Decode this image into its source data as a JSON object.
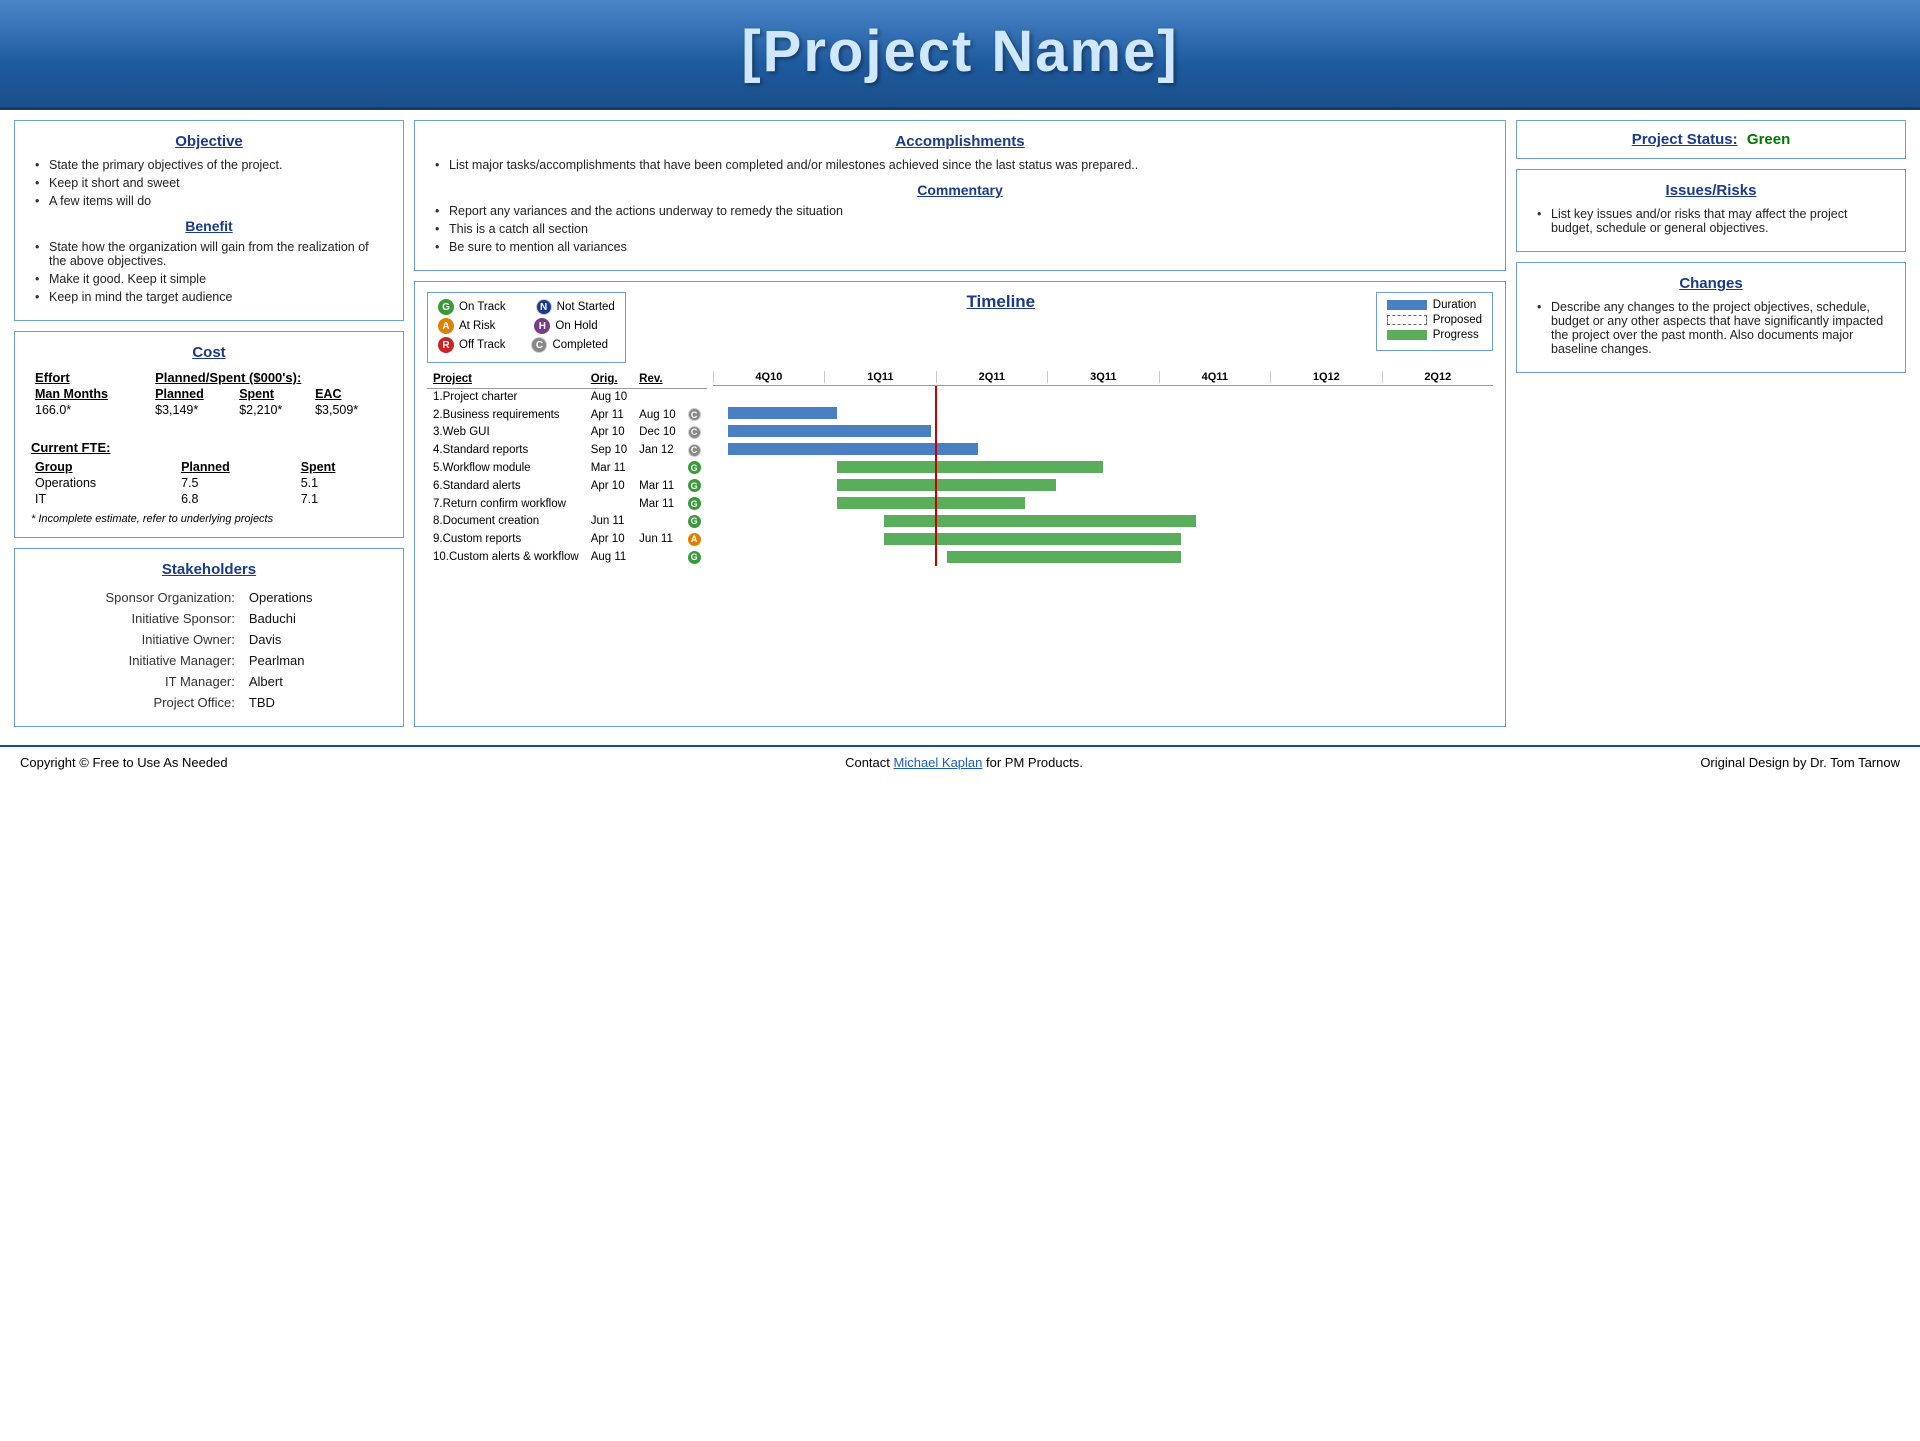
{
  "header": {
    "title": "[Project Name]"
  },
  "objective": {
    "title": "Objective",
    "items": [
      "State the primary objectives of the project.",
      "Keep it short and sweet",
      "A few items will do"
    ],
    "benefit_title": "Benefit",
    "benefit_items": [
      "State how the organization will gain from the realization of the above objectives.",
      "Make it good. Keep it simple",
      "Keep in mind the target audience"
    ]
  },
  "cost": {
    "title": "Cost",
    "effort_label": "Effort",
    "planned_spent_label": "Planned/Spent ($000's):",
    "columns": [
      "Man Months",
      "Planned",
      "Spent",
      "EAC"
    ],
    "values": [
      "166.0*",
      "$3,149*",
      "$2,210*",
      "$3,509*"
    ],
    "current_fte_label": "Current FTE:",
    "fte_columns": [
      "Group",
      "Planned",
      "Spent"
    ],
    "fte_rows": [
      [
        "Operations",
        "7.5",
        "5.1"
      ],
      [
        "IT",
        "6.8",
        "7.1"
      ]
    ],
    "footnote": "* Incomplete estimate, refer to underlying projects"
  },
  "stakeholders": {
    "title": "Stakeholders",
    "rows": [
      [
        "Sponsor Organization:",
        "Operations"
      ],
      [
        "Initiative Sponsor:",
        "Baduchi"
      ],
      [
        "Initiative Owner:",
        "Davis"
      ],
      [
        "Initiative Manager:",
        "Pearlman"
      ],
      [
        "IT Manager:",
        "Albert"
      ],
      [
        "Project Office:",
        "TBD"
      ]
    ]
  },
  "accomplishments": {
    "title": "Accomplishments",
    "items": [
      "List major tasks/accomplishments that have been completed and/or milestones achieved since the last status was prepared.."
    ],
    "commentary_title": "Commentary",
    "commentary_items": [
      "Report any variances and the actions underway to remedy the situation",
      "This is a catch all section",
      "Be sure to mention all variances"
    ]
  },
  "project_status": {
    "title": "Project Status:",
    "status": "Green"
  },
  "issues_risks": {
    "title": "Issues/Risks",
    "items": [
      "List key issues and/or risks that may affect the project budget, schedule or general objectives."
    ]
  },
  "changes": {
    "title": "Changes",
    "items": [
      "Describe any changes to the project objectives, schedule, budget or any other aspects that have significantly impacted the project over the past month. Also documents major baseline changes."
    ]
  },
  "legend": {
    "items": [
      {
        "symbol": "G",
        "color": "green",
        "label": "On Track"
      },
      {
        "symbol": "A",
        "color": "amber",
        "label": "At Risk"
      },
      {
        "symbol": "R",
        "color": "red",
        "label": "Off Track"
      },
      {
        "symbol": "N",
        "color": "navy",
        "label": "Not Started"
      },
      {
        "symbol": "H",
        "color": "purple",
        "label": "On Hold"
      },
      {
        "symbol": "C",
        "color": "grey",
        "label": "Completed"
      }
    ]
  },
  "duration_legend": {
    "items": [
      {
        "type": "duration",
        "label": "Duration"
      },
      {
        "type": "proposed",
        "label": "Proposed"
      },
      {
        "type": "progress",
        "label": "Progress"
      }
    ]
  },
  "timeline": {
    "title": "Timeline",
    "quarters": [
      "4Q10",
      "1Q11",
      "2Q11",
      "3Q11",
      "4Q11",
      "1Q12",
      "2Q12"
    ],
    "projects": [
      {
        "name": "1.Project charter",
        "orig": "Aug 10",
        "rev": "",
        "status": "",
        "bars": []
      },
      {
        "name": "2.Business requirements",
        "orig": "Apr 11",
        "rev": "Aug 10",
        "status": "C",
        "bars": [
          {
            "start": 0.05,
            "width": 0.13,
            "type": "blue"
          }
        ]
      },
      {
        "name": "3.Web GUI",
        "orig": "Apr 10",
        "rev": "Dec 10",
        "status": "C",
        "bars": [
          {
            "start": 0.05,
            "width": 0.25,
            "type": "blue"
          }
        ]
      },
      {
        "name": "4.Standard reports",
        "orig": "Sep 10",
        "rev": "Jan 12",
        "status": "C",
        "bars": [
          {
            "start": 0.05,
            "width": 0.3,
            "type": "blue"
          }
        ]
      },
      {
        "name": "5.Workflow module",
        "orig": "Mar 11",
        "rev": "",
        "status": "G",
        "bars": [
          {
            "start": 0.18,
            "width": 0.32,
            "type": "green"
          }
        ]
      },
      {
        "name": "6.Standard alerts",
        "orig": "Apr 10",
        "rev": "Mar 11",
        "status": "G",
        "bars": [
          {
            "start": 0.18,
            "width": 0.28,
            "type": "green"
          }
        ]
      },
      {
        "name": "7.Return confirm workflow",
        "orig": "",
        "rev": "Mar 11",
        "status": "G",
        "bars": [
          {
            "start": 0.18,
            "width": 0.24,
            "type": "green"
          }
        ]
      },
      {
        "name": "8.Document creation",
        "orig": "Jun 11",
        "rev": "",
        "status": "G",
        "bars": [
          {
            "start": 0.25,
            "width": 0.38,
            "type": "green"
          }
        ]
      },
      {
        "name": "9.Custom reports",
        "orig": "Apr 10",
        "rev": "Jun 11",
        "status": "A",
        "bars": [
          {
            "start": 0.25,
            "width": 0.35,
            "type": "green"
          }
        ]
      },
      {
        "name": "10.Custom alerts & workflow",
        "orig": "Aug 11",
        "rev": "",
        "status": "G",
        "bars": [
          {
            "start": 0.35,
            "width": 0.3,
            "type": "green"
          }
        ]
      }
    ]
  },
  "footer": {
    "copyright": "Copyright © Free to Use As Needed",
    "contact_pre": "Contact ",
    "contact_link": "Michael Kaplan",
    "contact_post": " for PM Products.",
    "credit": "Original Design by Dr. Tom Tarnow"
  }
}
